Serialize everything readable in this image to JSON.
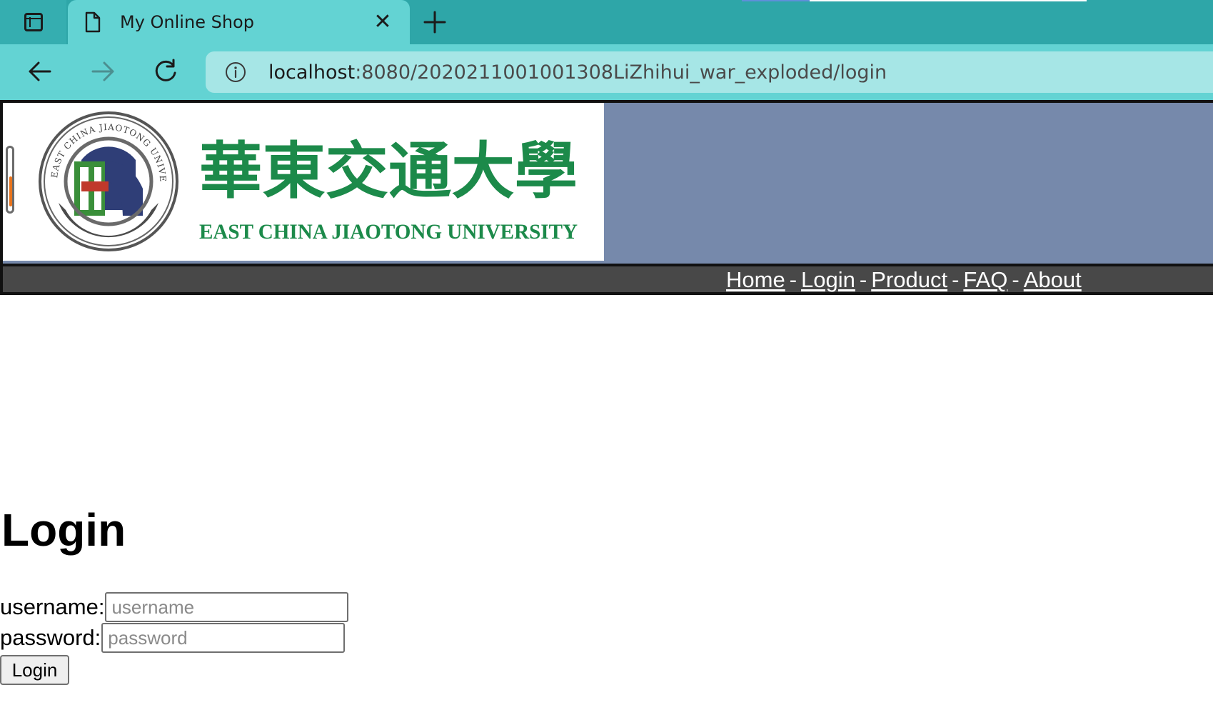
{
  "browser": {
    "tab_title": "My Online Shop",
    "address": {
      "host": "localhost",
      "rest": ":8080/202021100100130​8LiZhihui_war_exploded/login"
    }
  },
  "header": {
    "logo_title_chinese": "華東交通大學",
    "logo_subtitle": "EAST CHINA JIAOTONG UNIVERSITY",
    "background_color": "#7689ab"
  },
  "nav": {
    "links": [
      "Home",
      "Login",
      "Product",
      "FAQ",
      "About"
    ],
    "separator": "-"
  },
  "login": {
    "title": "Login",
    "username_label": "username:",
    "username_placeholder": "username",
    "password_label": "password:",
    "password_placeholder": "password",
    "submit_label": "Login"
  }
}
